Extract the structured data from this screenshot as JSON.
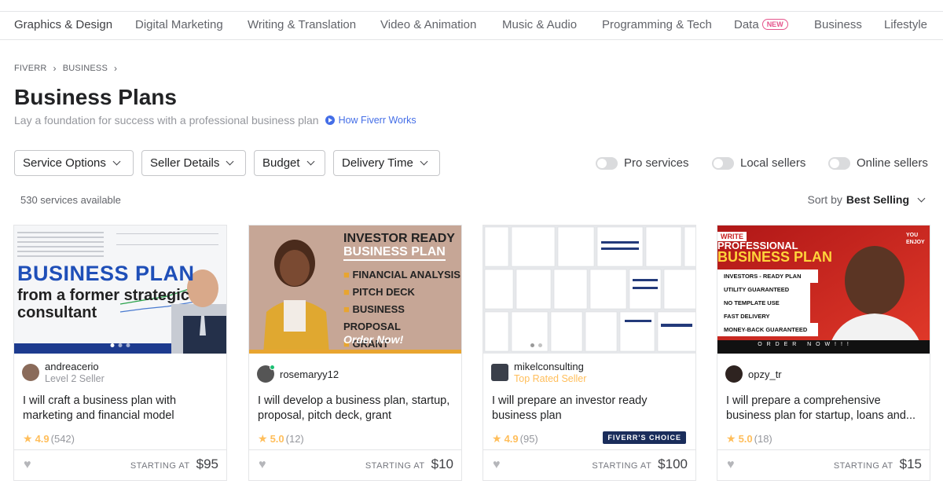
{
  "categories": [
    "Graphics & Design",
    "Digital Marketing",
    "Writing & Translation",
    "Video & Animation",
    "Music & Audio",
    "Programming & Tech",
    "Data",
    "Business",
    "Lifestyle"
  ],
  "new_badge": "NEW",
  "breadcrumb": [
    "FIVERR",
    "BUSINESS"
  ],
  "page": {
    "title": "Business Plans",
    "subtitle": "Lay a foundation for success with a professional business plan",
    "how_link": "How Fiverr Works"
  },
  "filters": [
    "Service Options",
    "Seller Details",
    "Budget",
    "Delivery Time"
  ],
  "toggles": [
    "Pro services",
    "Local sellers",
    "Online sellers"
  ],
  "results": {
    "count": "530 services available",
    "sort_label": "Sort by",
    "sort_value": "Best Selling"
  },
  "colors": {
    "accent_blue": "#446ee7",
    "star": "#ffbe5b",
    "new_pink": "#e5548c",
    "choice_navy": "#1a2d5b"
  },
  "gigs": [
    {
      "seller": "andreacerio",
      "level": "Level 2 Seller",
      "title": "I will craft a business plan with marketing and financial model",
      "score": "4.9",
      "reviews": "(542)",
      "price_label": "STARTING AT",
      "price": "$95",
      "thumb": {
        "line1": "BUSINESS PLAN",
        "line2": "from a former strategic",
        "line3": "consultant"
      }
    },
    {
      "seller": "rosemaryy12",
      "level": "",
      "title": "I will develop a business plan, startup, proposal, pitch deck, grant",
      "score": "5.0",
      "reviews": "(12)",
      "price_label": "STARTING AT",
      "price": "$10",
      "thumb": {
        "head1": "INVESTOR READY",
        "head2": "BUSINESS PLAN",
        "items": [
          "FINANCIAL ANALYSIS",
          "PITCH DECK",
          "BUSINESS PROPOSAL",
          "GRANT"
        ],
        "cta": "Order Now!"
      }
    },
    {
      "seller": "mikelconsulting",
      "level": "Top Rated Seller",
      "title": "I will prepare an investor ready business plan",
      "score": "4.9",
      "reviews": "(95)",
      "price_label": "STARTING AT",
      "price": "$100",
      "badge": "FIVERR'S CHOICE"
    },
    {
      "seller": "opzy_tr",
      "level": "",
      "title": "I will prepare a comprehensive business plan for startup, loans and...",
      "score": "5.0",
      "reviews": "(18)",
      "price_label": "STARTING AT",
      "price": "$15",
      "thumb": {
        "tag": "WRITE",
        "h1": "PROFESSIONAL",
        "h2": "BUSINESS PLAN",
        "list": [
          "INVESTORS - READY PLAN",
          "UTILITY GUARANTEED",
          "NO TEMPLATE USE",
          "FAST DELIVERY",
          "MONEY-BACK GUARANTEED"
        ],
        "order": "O R D E R   N O W ! ! !",
        "corner": "YOU ENJOY"
      }
    }
  ]
}
